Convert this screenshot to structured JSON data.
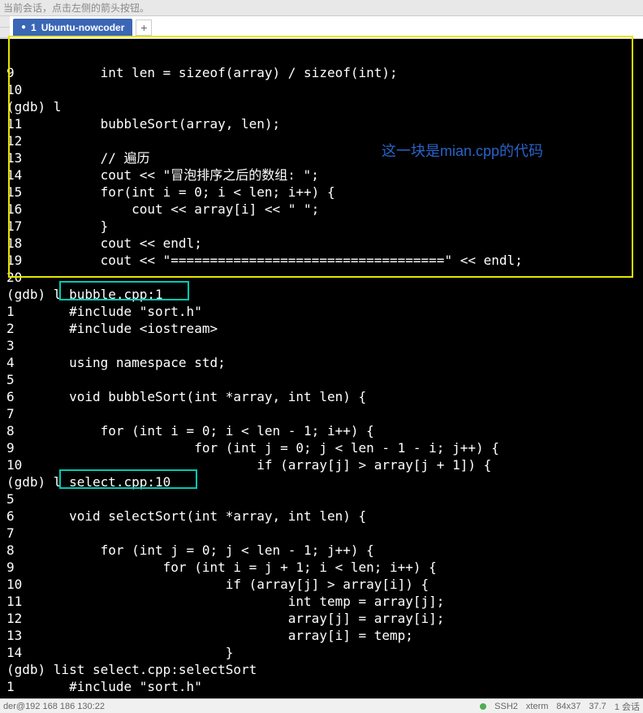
{
  "hint": "当前会话，点击左侧的箭头按钮。",
  "tab": {
    "index": "1",
    "title": "Ubuntu-nowcoder"
  },
  "annotation": "这一块是mian.cpp的代码",
  "terminal_lines": [
    "",
    "9           int len = sizeof(array) / sizeof(int);",
    "10",
    "(gdb) l",
    "11          bubbleSort(array, len);",
    "12",
    "13          // 遍历",
    "14          cout << \"冒泡排序之后的数组: \";",
    "15          for(int i = 0; i < len; i++) {",
    "16              cout << array[i] << \" \";",
    "17          }",
    "18          cout << endl;",
    "19          cout << \"===================================\" << endl;",
    "20",
    "(gdb) l bubble.cpp:1",
    "1       #include \"sort.h\"",
    "2       #include <iostream>",
    "3",
    "4       using namespace std;",
    "5",
    "6       void bubbleSort(int *array, int len) {",
    "7",
    "8           for (int i = 0; i < len - 1; i++) {",
    "9                       for (int j = 0; j < len - 1 - i; j++) {",
    "10                              if (array[j] > array[j + 1]) {",
    "(gdb) l select.cpp:10",
    "5",
    "6       void selectSort(int *array, int len) {",
    "7",
    "8           for (int j = 0; j < len - 1; j++) {",
    "9                   for (int i = j + 1; i < len; i++) {",
    "10                          if (array[j] > array[i]) {",
    "11                                  int temp = array[j];",
    "12                                  array[j] = array[i];",
    "13                                  array[i] = temp;",
    "14                          }",
    "(gdb) list select.cpp:selectSort",
    "1       #include \"sort.h\""
  ],
  "status": {
    "left": "der@192 168 186 130:22",
    "ssh": "SSH2",
    "term": "xterm",
    "size": "84x37",
    "pos": "37.7",
    "sess": "1 会话"
  }
}
